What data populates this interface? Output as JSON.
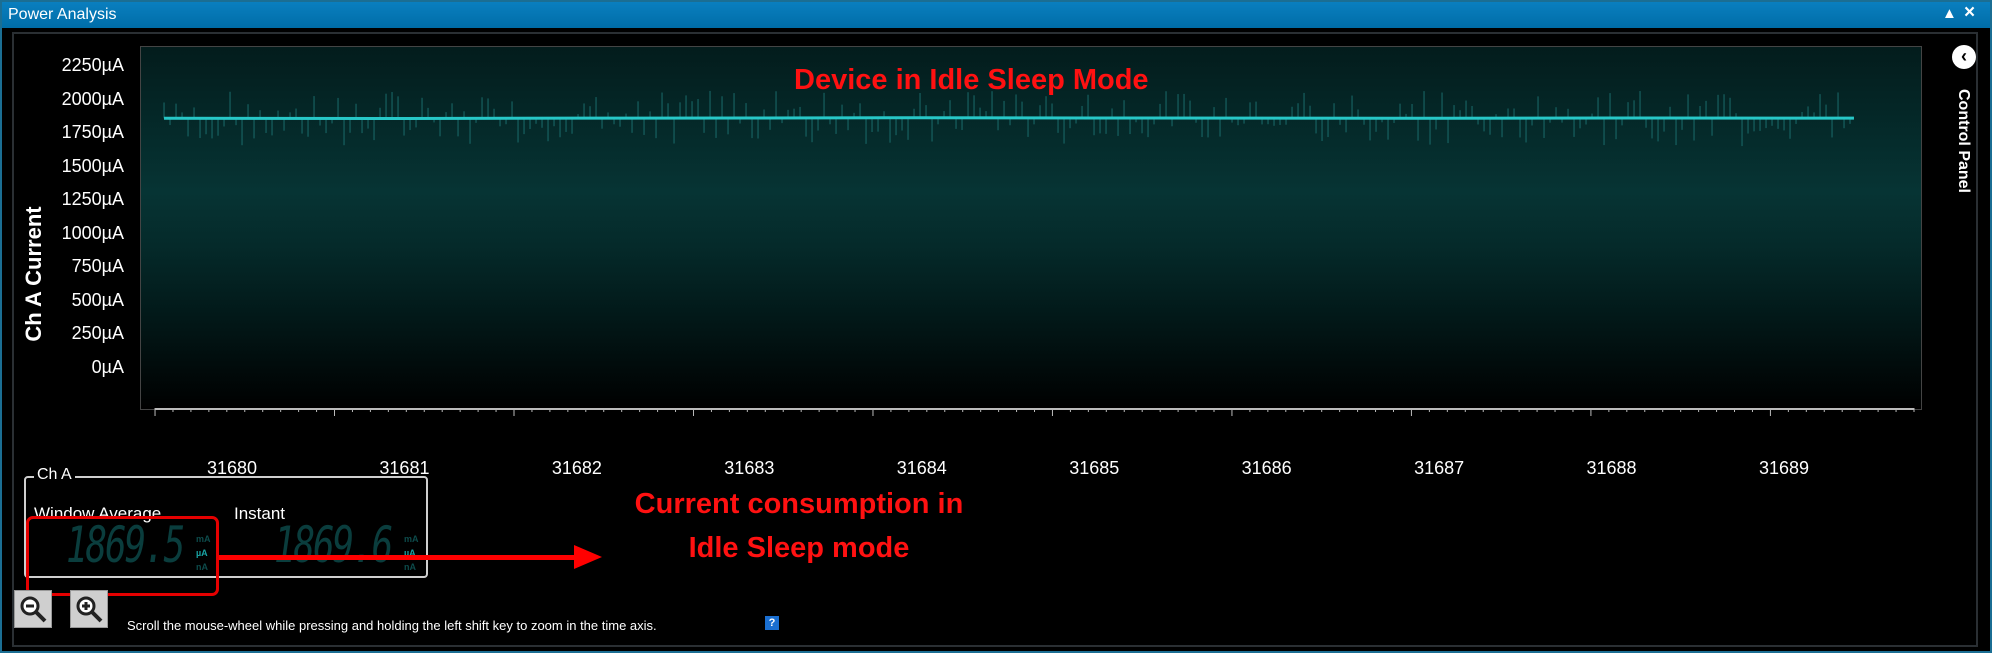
{
  "window": {
    "title": "Power Analysis",
    "collapse_icon": "▲",
    "close_icon": "×"
  },
  "chart_data": {
    "type": "line",
    "title": "",
    "ylabel": "Ch A Current",
    "xlabel": "",
    "ylim": [
      0,
      2250
    ],
    "xlim": [
      31679.6,
      31689.4
    ],
    "y_ticks": [
      "2250µA",
      "2000µA",
      "1750µA",
      "1500µA",
      "1250µA",
      "1000µA",
      "750µA",
      "500µA",
      "250µA",
      "0µA"
    ],
    "x_ticks": [
      "31680",
      "31681",
      "31682",
      "31683",
      "31684",
      "31685",
      "31686",
      "31687",
      "31688",
      "31689"
    ],
    "series": [
      {
        "x": [
          31679.6,
          31681.0,
          31682.0,
          31683.0,
          31684.0,
          31685.0,
          31686.0,
          31687.0,
          31688.0,
          31689.4
        ],
        "y": [
          1868,
          1866,
          1869,
          1870,
          1872,
          1870,
          1869,
          1868,
          1870,
          1869
        ]
      }
    ],
    "color": "#27c7c7",
    "grid": false
  },
  "annotations": {
    "plot_title": "Device in Idle Sleep Mode",
    "current_line1": "Current consumption in",
    "current_line2": "Idle Sleep mode"
  },
  "control_panel": {
    "label": "Control Panel",
    "toggle_icon": "‹"
  },
  "channel": {
    "label": "Ch A",
    "window_average": {
      "label": "Window Average",
      "value": "1869.5",
      "units": [
        "mA",
        "µA",
        "nA"
      ],
      "active_unit": "µA"
    },
    "instant": {
      "label": "Instant",
      "value": "1869.6",
      "units": [
        "mA",
        "µA",
        "nA"
      ],
      "active_unit": "µA"
    }
  },
  "footer": {
    "hint": "Scroll the mouse-wheel while pressing and holding the left shift key to zoom in the time axis.",
    "help_icon": "?"
  },
  "colors": {
    "title_bar": "#007acc",
    "trace": "#27c7c7",
    "annotation": "#ff1111"
  }
}
